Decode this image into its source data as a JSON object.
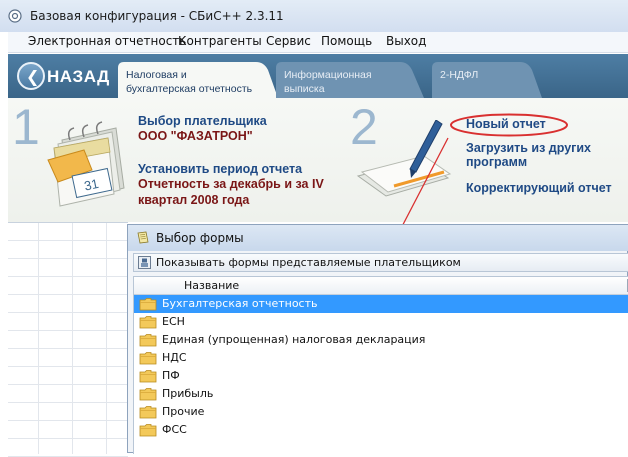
{
  "window": {
    "title": "Базовая конфигурация - СБиС++ 2.3.11"
  },
  "menu": {
    "items": [
      "Электронная отчетность",
      "Контрагенты",
      "Сервис",
      "Помощь",
      "Выход"
    ]
  },
  "nav": {
    "back_label": "НАЗАД",
    "tabs": [
      {
        "line1": "Налоговая и",
        "line2": "бухгалтерская отчетность",
        "active": true
      },
      {
        "line1": "Информационная",
        "line2": "выписка",
        "active": false
      },
      {
        "line1": "2-НДФЛ",
        "line2": "",
        "active": false
      }
    ]
  },
  "steps": {
    "step1": {
      "number": "1",
      "select_payer": "Выбор плательщика",
      "payer_name": "ООО \"ФАЗАТРОН\"",
      "set_period": "Установить период отчета",
      "period_line1": "Отчетность за декабрь и за IV",
      "period_line2": "квартал 2008 года",
      "calendar_day": "31"
    },
    "step2": {
      "number": "2",
      "new_report": "Новый отчет",
      "load_line1": "Загрузить из других",
      "load_line2": "программ",
      "corrective": "Корректирующий отчет"
    }
  },
  "dialog": {
    "title": "Выбор формы",
    "filter_label": "Показывать формы представляемые плательщиком",
    "column_name": "Название",
    "rows": [
      "Бухгалтерская отчетность",
      "ЕСН",
      "Единая (упрощенная) налоговая декларация",
      "НДС",
      "ПФ",
      "Прибыль",
      "Прочие",
      "ФСС"
    ],
    "selected_index": 0
  },
  "colors": {
    "tab_strip": "#3f6a8e",
    "highlight_oval": "#d93030",
    "arrow": "#d93030",
    "link": "#1f4a85",
    "value": "#7a1616",
    "selection": "#3399ff"
  }
}
